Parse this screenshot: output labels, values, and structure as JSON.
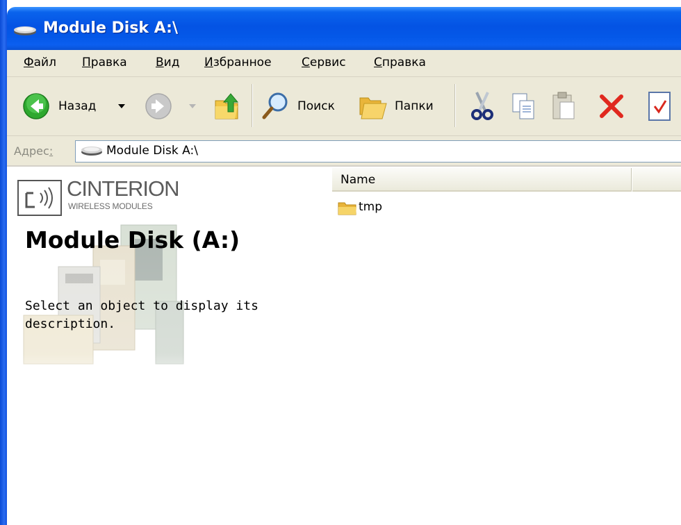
{
  "window": {
    "title": "Module Disk A:\\"
  },
  "menu": {
    "items": [
      {
        "key": "Ф",
        "rest": "айл"
      },
      {
        "key": "П",
        "rest": "равка"
      },
      {
        "key": "В",
        "rest": "ид"
      },
      {
        "key": "И",
        "rest": "збранное"
      },
      {
        "key": "С",
        "rest": "ервис"
      },
      {
        "key": "С",
        "rest": "правка"
      }
    ]
  },
  "toolbar": {
    "back_label": "Назад",
    "search_label": "Поиск",
    "folders_label": "Папки"
  },
  "address": {
    "label_pre": "Адрес",
    "label_key": ":",
    "value": "Module Disk A:\\"
  },
  "left_pane": {
    "brand": "CINTERION",
    "brand_sub": "WIRELESS MODULES",
    "title": "Module Disk (A:)",
    "description": "Select an object to display its description."
  },
  "file_list": {
    "columns": [
      "Name"
    ],
    "items": [
      {
        "name": "tmp",
        "icon": "folder-icon"
      }
    ]
  }
}
